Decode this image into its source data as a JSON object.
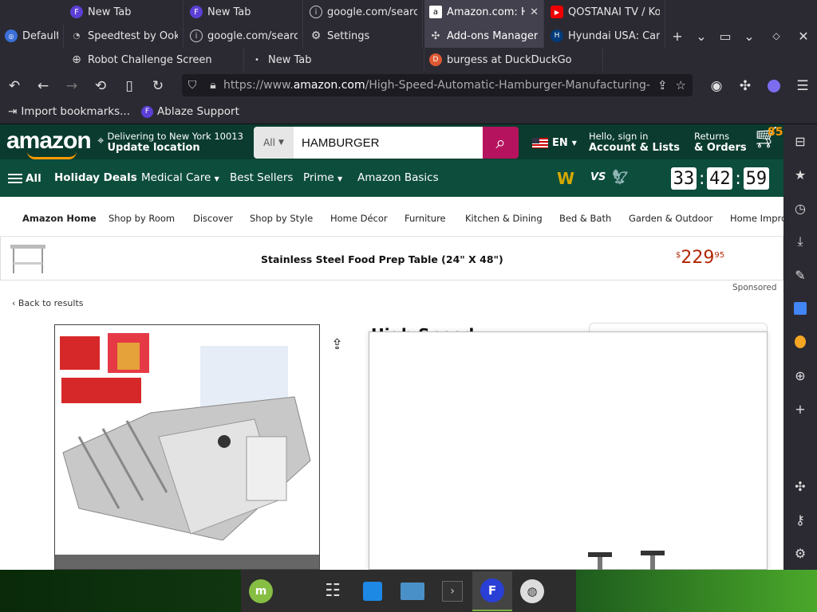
{
  "browser": {
    "tabs_row1": [
      {
        "label": "New Tab",
        "icon": "firefox-icon"
      },
      {
        "label": "New Tab",
        "icon": "firefox-icon"
      },
      {
        "label": "google.com/search",
        "icon": "info-icon"
      },
      {
        "label": "Amazon.com: High",
        "icon": "amazon-icon",
        "active": true
      },
      {
        "label": "QOSTANAI TV / Ko",
        "icon": "youtube-icon"
      }
    ],
    "tabs_row2": [
      {
        "label": "Default"
      },
      {
        "label": "Speedtest by Ookla"
      },
      {
        "label": "google.com/search"
      },
      {
        "label": "Settings"
      },
      {
        "label": "Add-ons Manager"
      },
      {
        "label": "Hyundai USA: Cars"
      }
    ],
    "tabs_row3": [
      {
        "label": "Robot Challenge Screen"
      },
      {
        "label": "New Tab"
      },
      {
        "label": "burgess at DuckDuckGo"
      }
    ],
    "url": {
      "prefix": "https://www.",
      "host": "amazon.com",
      "path": "/High-Speed-Automatic-Hamburger-Manufacturing-M"
    },
    "bookmarks": [
      {
        "label": "Import bookmarks..."
      },
      {
        "label": "Ablaze Support"
      }
    ]
  },
  "amazon": {
    "logo": "amazon",
    "deliver_line1": "Delivering to New York 10013",
    "deliver_line2": "Update location",
    "search_category": "All",
    "search_value": "HAMBURGER",
    "lang": "EN",
    "account_line1": "Hello, sign in",
    "account_line2": "Account & Lists",
    "orders_line1": "Returns",
    "orders_line2": "& Orders",
    "cart_count": "85",
    "nav": {
      "all": "All",
      "holiday": "Holiday Deals",
      "medical": "Medical Care",
      "best": "Best Sellers",
      "prime": "Prime",
      "basics": "Amazon Basics",
      "vs": "VS"
    },
    "clock": {
      "h": "33",
      "m": "42",
      "s": "59"
    },
    "subnav": [
      "Amazon Home",
      "Shop by Room",
      "Discover",
      "Shop by Style",
      "Home Décor",
      "Furniture",
      "Kitchen & Dining",
      "Bed & Bath",
      "Garden & Outdoor",
      "Home Impro"
    ],
    "ad": {
      "title": "Stainless Steel Food Prep Table (24\" X 48\")",
      "price_symbol": "$",
      "price_whole": "229",
      "price_frac": "95"
    },
    "sponsored": "Sponsored",
    "back": "Back to results",
    "title_partial": "High Speed"
  }
}
